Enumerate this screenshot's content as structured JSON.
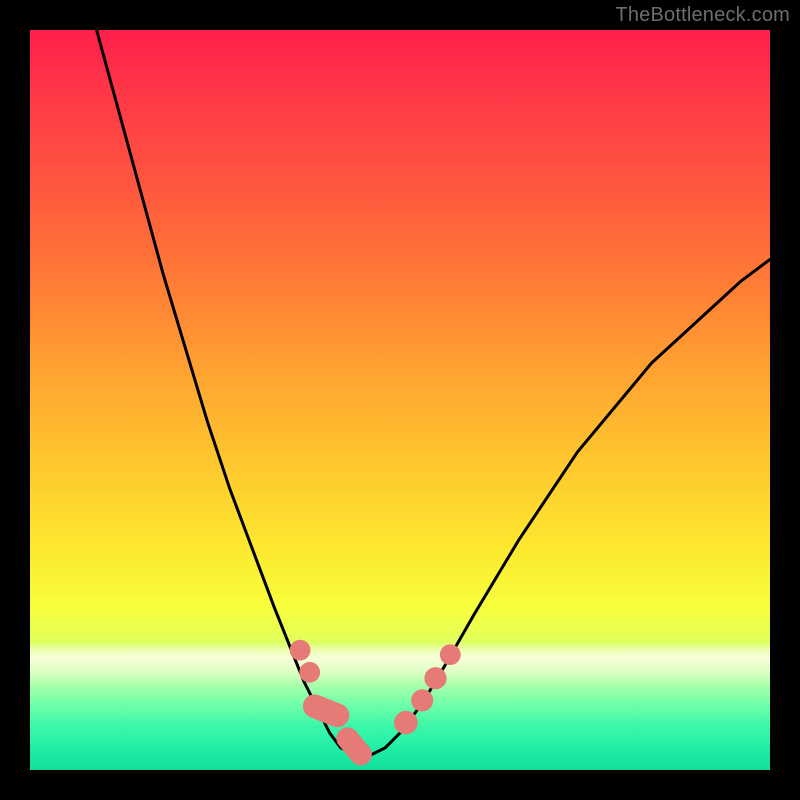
{
  "watermark": "TheBottleneck.com",
  "colors": {
    "frame": "#000000",
    "curve": "#000000",
    "marker_fill": "#e67a76",
    "marker_stroke": "#c85a57"
  },
  "chart_data": {
    "type": "line",
    "title": "",
    "xlabel": "",
    "ylabel": "",
    "xlim": [
      0,
      100
    ],
    "ylim": [
      0,
      100
    ],
    "series": [
      {
        "name": "bottleneck-curve",
        "x": [
          9,
          12,
          15,
          18,
          21,
          24,
          27,
          30,
          33,
          35,
          37,
          39,
          40.5,
          42,
          44,
          46,
          48,
          50,
          53,
          56,
          60,
          66,
          74,
          84,
          96,
          100
        ],
        "y": [
          100,
          89,
          78,
          67,
          57,
          47,
          38,
          30,
          22,
          17,
          12,
          8,
          5,
          3,
          2,
          2,
          3,
          5,
          9,
          14,
          21,
          31,
          43,
          55,
          66,
          69
        ]
      }
    ],
    "markers": [
      {
        "shape": "circle",
        "cx": 36.5,
        "cy": 16.2,
        "r": 1.4
      },
      {
        "shape": "circle",
        "cx": 37.8,
        "cy": 13.2,
        "r": 1.4
      },
      {
        "shape": "pill",
        "cx": 40.0,
        "cy": 8.0,
        "w": 3.2,
        "h": 6.5,
        "rot": -68
      },
      {
        "shape": "pill",
        "cx": 43.8,
        "cy": 3.2,
        "w": 3.0,
        "h": 5.8,
        "rot": -40
      },
      {
        "shape": "circle",
        "cx": 50.8,
        "cy": 6.4,
        "r": 1.6
      },
      {
        "shape": "circle",
        "cx": 53.0,
        "cy": 9.4,
        "r": 1.5
      },
      {
        "shape": "circle",
        "cx": 54.8,
        "cy": 12.4,
        "r": 1.5
      },
      {
        "shape": "circle",
        "cx": 56.8,
        "cy": 15.6,
        "r": 1.4
      }
    ]
  }
}
